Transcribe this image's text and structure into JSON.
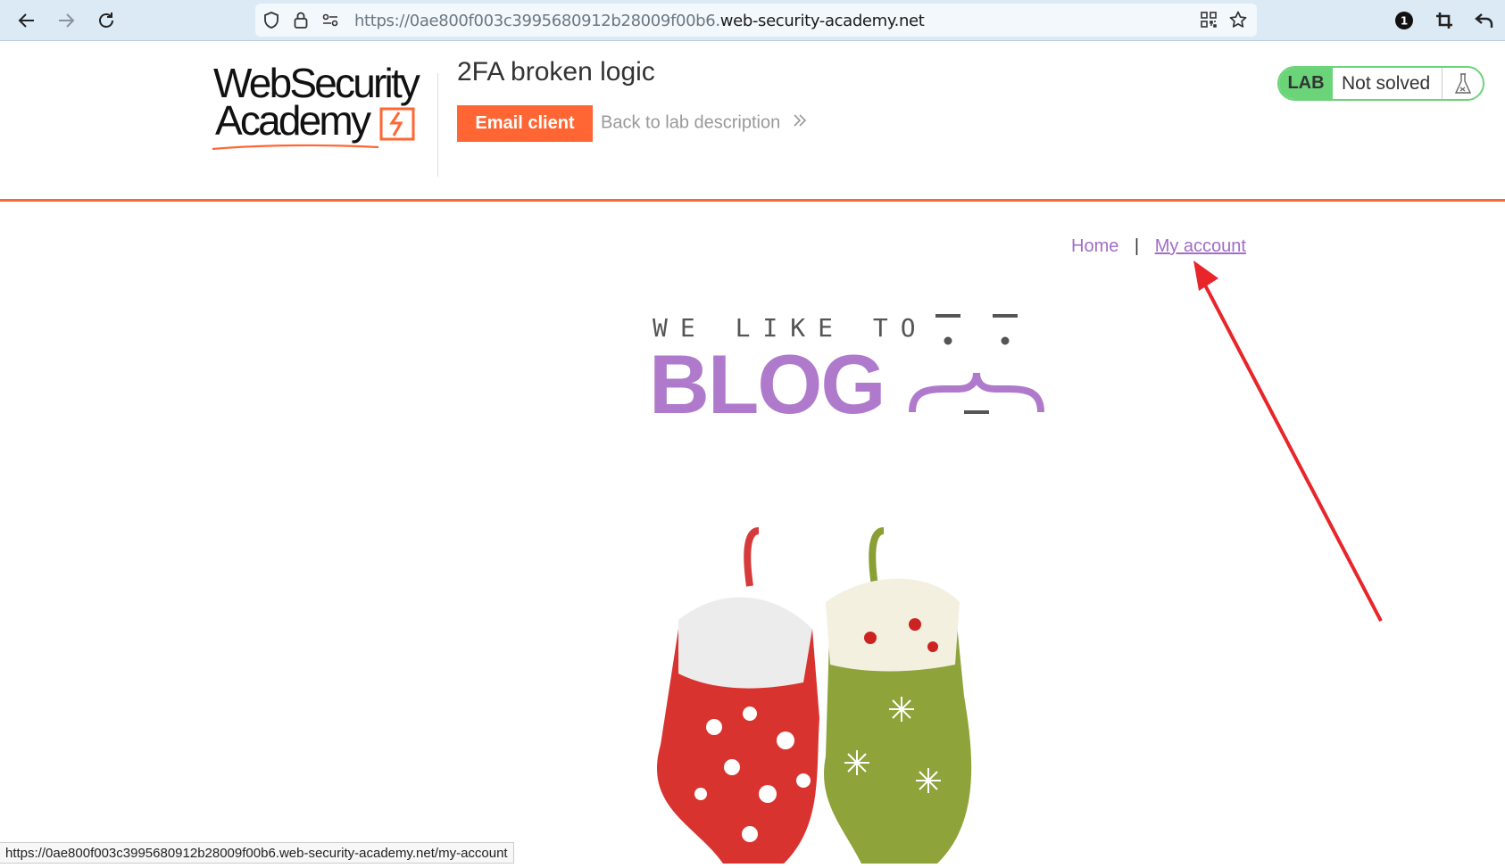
{
  "browser": {
    "url_prefix": "https://0ae800f003c3995680912b28009f00b6.",
    "url_domain": "web-security-academy.net",
    "status_url": "https://0ae800f003c3995680912b28009f00b6.web-security-academy.net/my-account"
  },
  "header": {
    "logo_line1": "WebSecurity",
    "logo_line2": "Academy",
    "lab_title": "2FA broken logic",
    "email_client_label": "Email client",
    "back_link_label": "Back to lab description",
    "lab_badge": "LAB",
    "lab_status": "Not solved"
  },
  "nav": {
    "home_label": "Home",
    "separator": "|",
    "account_label": "My account"
  },
  "banner": {
    "small_text": "WE LIKE TO",
    "big_text": "BLOG"
  },
  "colors": {
    "accent_orange": "#ff6633",
    "lab_green": "#6bd479",
    "link_purple": "#a36cc7",
    "blog_purple": "#b07acc",
    "annotation_red": "#e8252a"
  }
}
